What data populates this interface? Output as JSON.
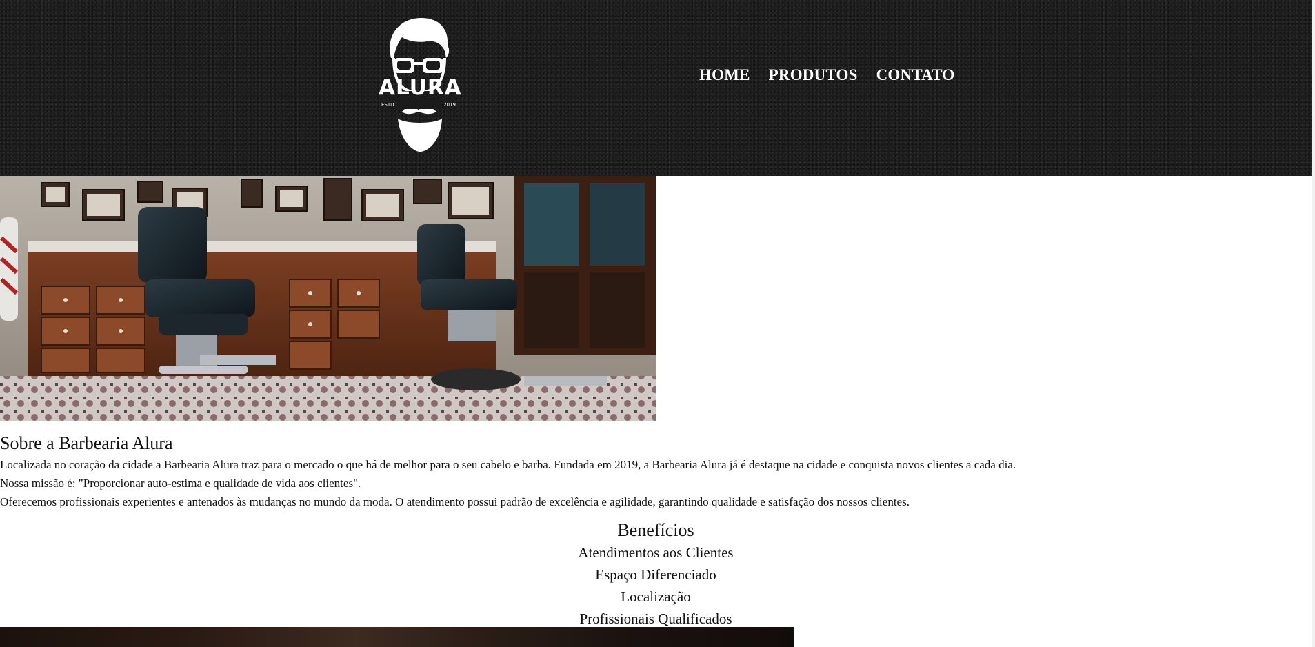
{
  "header": {
    "logo": {
      "brand": "ALURA",
      "estd_left": "ESTD",
      "estd_right": "2019"
    },
    "nav": [
      {
        "label": "HOME"
      },
      {
        "label": "PRODUTOS"
      },
      {
        "label": "CONTATO"
      }
    ]
  },
  "about": {
    "title": "Sobre a Barbearia Alura",
    "paragraphs": [
      "Localizada no coração da cidade a Barbearia Alura traz para o mercado o que há de melhor para o seu cabelo e barba. Fundada em 2019, a Barbearia Alura já é destaque na cidade e conquista novos clientes a cada dia.",
      "Nossa missão é: \"Proporcionar auto-estima e qualidade de vida aos clientes\".",
      "Oferecemos profissionais experientes e antenados às mudanças no mundo da moda. O atendimento possui padrão de excelência e agilidade, garantindo qualidade e satisfação dos nossos clientes."
    ]
  },
  "benefits": {
    "title": "Benefícios",
    "items": [
      "Atendimentos aos Clientes",
      "Espaço Diferenciado",
      "Localização",
      "Profissionais Qualificados"
    ]
  },
  "colors": {
    "header_bg": "#1b1b1b",
    "nav_text": "#ffffff",
    "body_text": "#111111"
  }
}
